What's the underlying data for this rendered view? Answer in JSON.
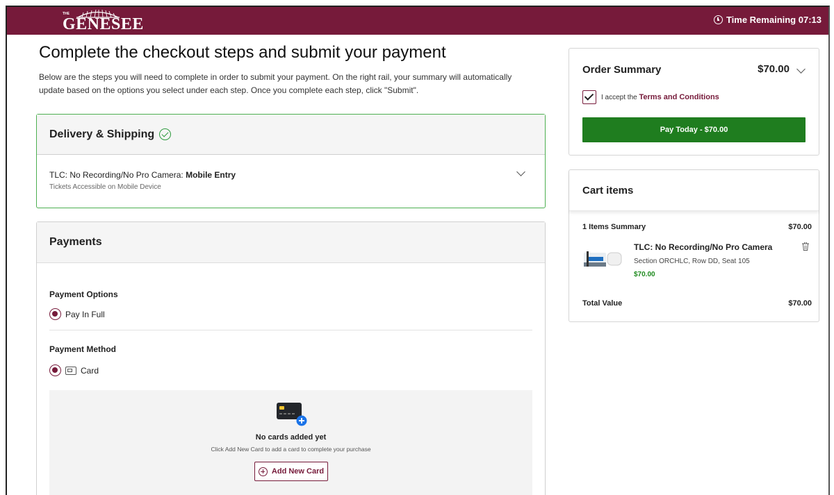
{
  "header": {
    "logo_small": "THE",
    "logo_text": "GENESEE",
    "timer_label": "Time Remaining 07:13"
  },
  "page": {
    "title": "Complete the checkout steps and submit your payment",
    "intro": "Below are the steps you will need to complete in order to submit your payment. On the right rail, your summary will automatically update based on the options you select under each step. Once you complete each step, click \"Submit\"."
  },
  "delivery": {
    "title": "Delivery & Shipping",
    "item_prefix": "TLC: No Recording/No Pro Camera: ",
    "item_method": "Mobile Entry",
    "item_sub": "Tickets Accessible on Mobile Device"
  },
  "payments": {
    "title": "Payments",
    "options_label": "Payment Options",
    "option_selected": "Pay In Full",
    "method_label": "Payment Method",
    "method_selected": "Card",
    "no_cards_title": "No cards added yet",
    "no_cards_sub": "Click Add New Card to add a card to complete your purchase",
    "add_card_label": "Add New Card"
  },
  "order_summary": {
    "title": "Order Summary",
    "amount": "$70.00",
    "terms_prefix": "I accept the ",
    "terms_link": "Terms and Conditions",
    "terms_checked": true,
    "pay_button": "Pay Today - $70.00"
  },
  "cart": {
    "title": "Cart items",
    "summary_label": "1 Items Summary",
    "summary_amount": "$70.00",
    "item_title": "TLC: No Recording/No Pro Camera",
    "item_detail": "Section ORCHLC, Row DD, Seat 105",
    "item_price": "$70.00",
    "total_label": "Total Value",
    "total_amount": "$70.00"
  },
  "colors": {
    "brand": "#761a3a",
    "success": "#1f7d1f",
    "accent_blue": "#1a73e8"
  }
}
